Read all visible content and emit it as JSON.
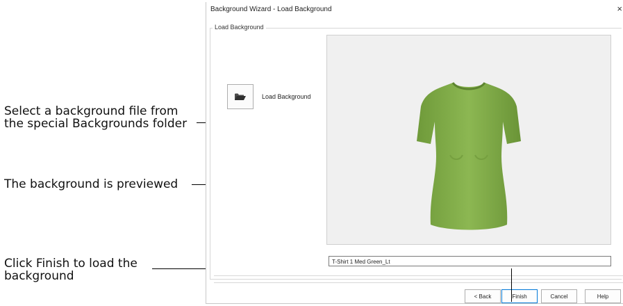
{
  "callouts": {
    "select_line1": "Select a background file from",
    "select_line2": "the special Backgrounds folder",
    "preview": "The background is previewed",
    "finish_line1": "Click Finish to load the",
    "finish_line2": "background"
  },
  "dialog": {
    "title": "Background Wizard - Load Background",
    "close_glyph": "×",
    "group_label": "Load Background",
    "load_button_label": "Load Background",
    "file_name": "T-Shirt 1 Med Green_Lt",
    "buttons": {
      "back": "< Back",
      "finish": "Finish",
      "cancel": "Cancel",
      "help": "Help"
    }
  },
  "icons": {
    "load": "folder-open-icon",
    "close": "close-icon"
  },
  "colors": {
    "shirt": "#84b04a",
    "preview_bg": "#f0f0f0",
    "focus": "#0078d7"
  }
}
